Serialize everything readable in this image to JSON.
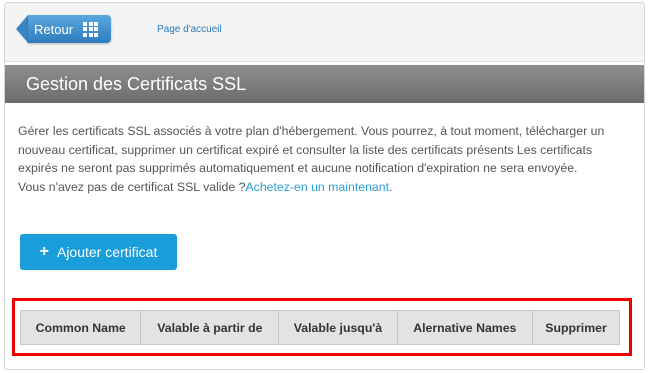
{
  "nav": {
    "back_label": "Retour",
    "back_icon": "grid-icon",
    "home_link": "Page d'accueil"
  },
  "header": {
    "title": "Gestion des Certificats SSL"
  },
  "content": {
    "description": "Gérer les certificats SSL associés à votre plan d'hébergement. Vous pourrez, à tout moment, télécharger un nouveau certificat, supprimer un certificat expiré et consulter la liste des certificats présents Les certificats expirés ne seront pas supprimés automatiquement et aucune notification d'expiration ne sera envoyée.",
    "no_cert_text": "Vous n'avez pas de certificat SSL valide ?",
    "buy_link": "Achetez-en un maintenant",
    "after_link": "."
  },
  "actions": {
    "add_icon": "+",
    "add_label": "Ajouter certificat"
  },
  "table": {
    "columns": [
      "Common Name",
      "Valable à partir de",
      "Valable jusqu'à",
      "Alernative Names",
      "Supprimer"
    ]
  },
  "colors": {
    "accent": "#1a9ed9",
    "back_button": "#3a86c4",
    "highlight": "#ee0000",
    "title_bar": "#7a7a7a"
  }
}
